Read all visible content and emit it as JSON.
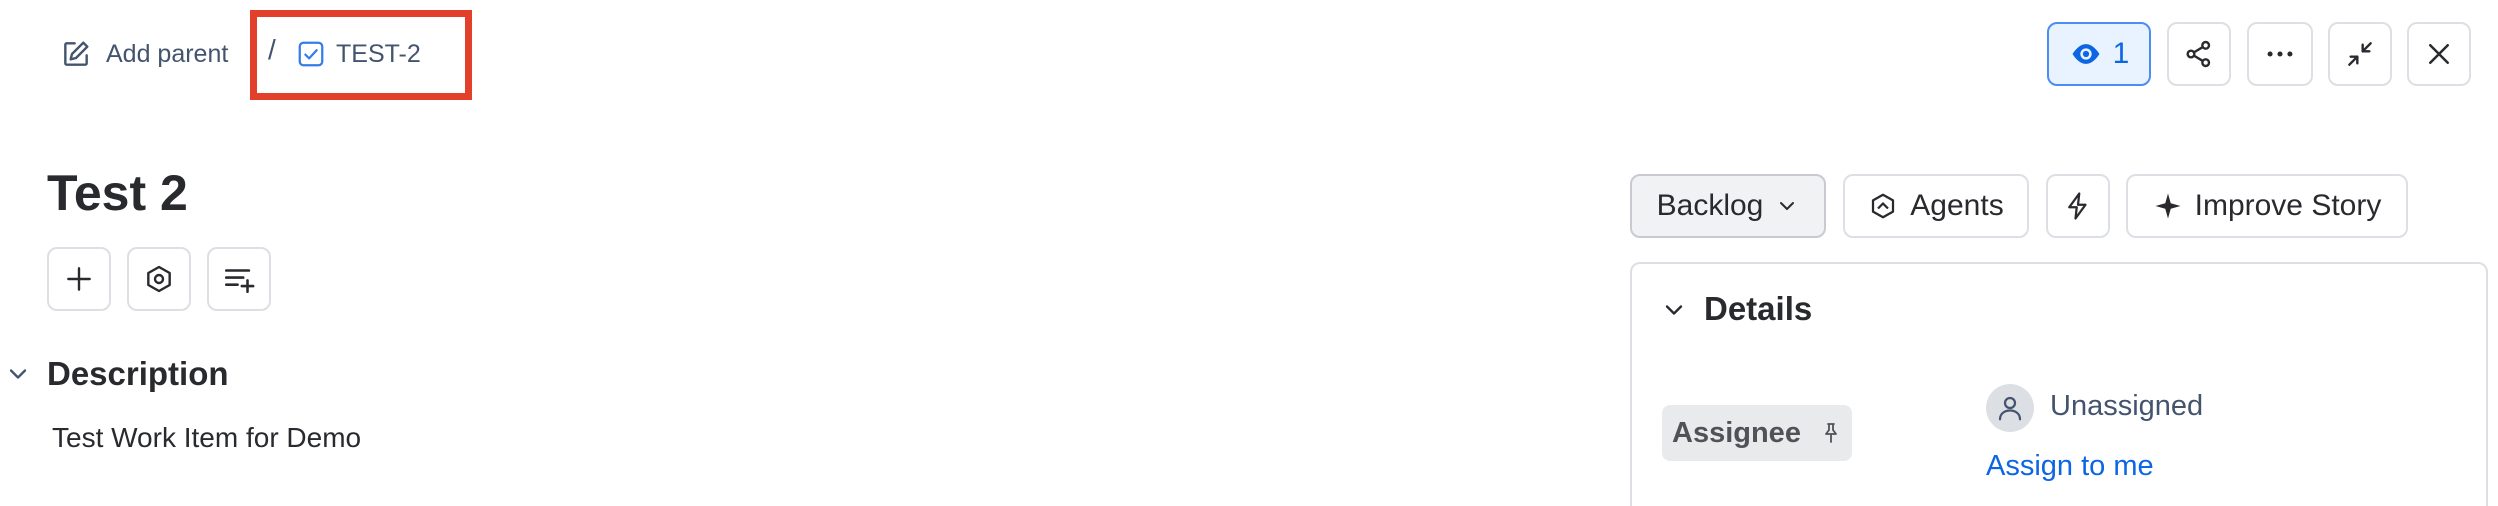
{
  "breadcrumb": {
    "add_parent_label": "Add parent",
    "separator": "/",
    "issue_key": "TEST-2"
  },
  "header_actions": {
    "watch_count": "1"
  },
  "issue": {
    "title": "Test 2",
    "description_heading": "Description",
    "description_text": "Test Work Item for Demo"
  },
  "action_bar": {
    "status_label": "Backlog",
    "agents_label": "Agents",
    "improve_label": "Improve Story"
  },
  "details": {
    "heading": "Details",
    "assignee_label": "Assignee",
    "assignee_value": "Unassigned",
    "assign_to_me_label": "Assign to me"
  },
  "colors": {
    "accent": "#0c66e4",
    "highlight_border": "#e2402b",
    "text": "#292a2e",
    "muted": "#44546f",
    "border": "#dcdfe4"
  },
  "icons": {
    "add_parent": "pencil-square-icon",
    "issue_type": "checkbox-task-icon",
    "watch": "eye-icon",
    "share": "share-icon",
    "more": "more-horizontal-icon",
    "minimize": "minimize-icon",
    "close": "close-icon"
  }
}
